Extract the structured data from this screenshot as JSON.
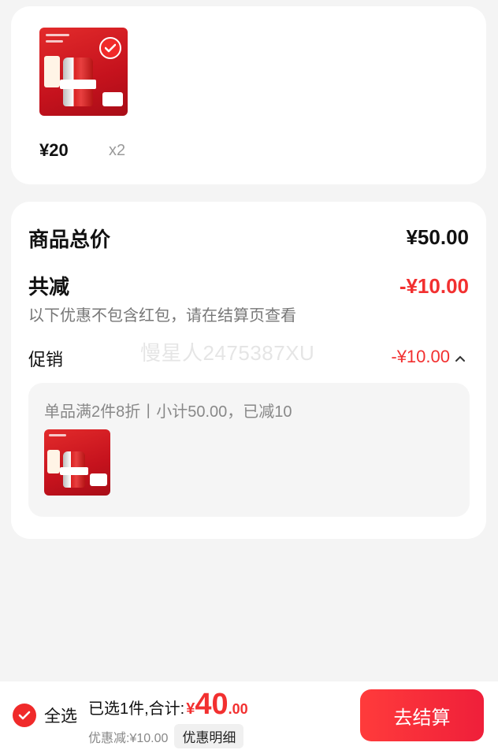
{
  "cart_item": {
    "price": "¥20",
    "quantity": "x2",
    "image_icon": "budweiser-beer-product-image"
  },
  "summary": {
    "total_label": "商品总价",
    "total_value": "¥50.00",
    "reduce_label": "共减",
    "reduce_value": "-¥10.00",
    "note": "以下优惠不包含红包，请在结算页查看",
    "promo_label": "促销",
    "promo_value": "-¥10.00",
    "promo_chevron": "^",
    "promo_desc": "单品满2件8折丨小计50.00，已减10"
  },
  "watermark": "慢星人2475387XU",
  "bottom_bar": {
    "select_all_label": "全选",
    "selected_text": "已选1件,合计:",
    "currency_symbol": "¥",
    "amount_int": "40",
    "amount_dec": ".00",
    "discount_text": "优惠减:¥10.00",
    "detail_label": "优惠明细",
    "checkout_label": "去结算"
  },
  "colors": {
    "accent": "#f23030",
    "background": "#f4f4f4",
    "card": "#ffffff"
  }
}
